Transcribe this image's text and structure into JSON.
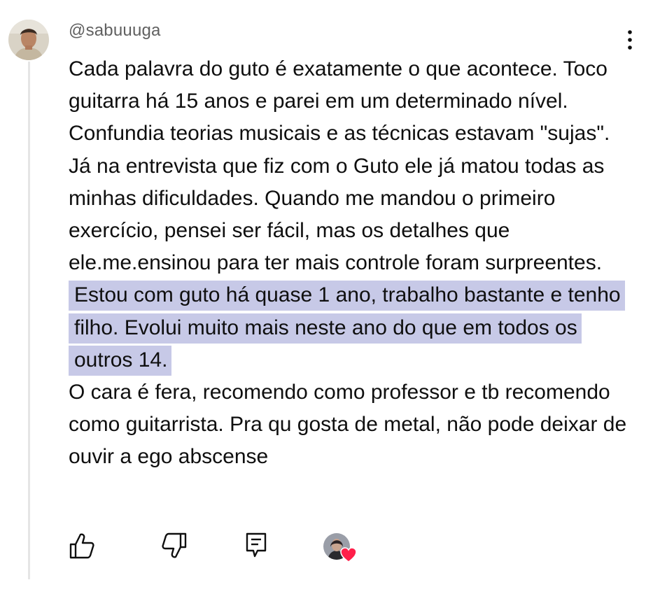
{
  "comment": {
    "author": "@sabuuuga",
    "text_before_highlight": "Cada palavra do guto é exatamente o que acontece. Toco guitarra há 15 anos e parei em um determinado nível. Confundia teorias musicais e as técnicas estavam \"sujas\". Já na entrevista que fiz com o Guto ele já matou todas as minhas dificuldades. Quando me mandou o primeiro exercício,  pensei ser fácil, mas os detalhes que ele.me.ensinou para ter mais controle foram surpreentes.",
    "text_highlighted": "Estou com guto há quase 1 ano, trabalho bastante e tenho filho. Evolui muito mais neste ano do que em todos os outros 14.",
    "text_after_highlight": "O cara é fera, recomendo como professor e tb recomendo como guitarrista. Pra qu gosta de metal, não pode deixar de ouvir a ego abscense",
    "highlight_color": "#c7c9e7"
  },
  "icons": {
    "menu": "more-vertical-icon",
    "like": "thumbs-up-icon",
    "dislike": "thumbs-down-icon",
    "reply": "reply-comment-icon",
    "creator_heart": "creator-heart-icon"
  },
  "colors": {
    "text": "#0f0f0f",
    "username": "#606060",
    "heart": "#ff1f4a",
    "thread_line": "#e5e5e5"
  }
}
